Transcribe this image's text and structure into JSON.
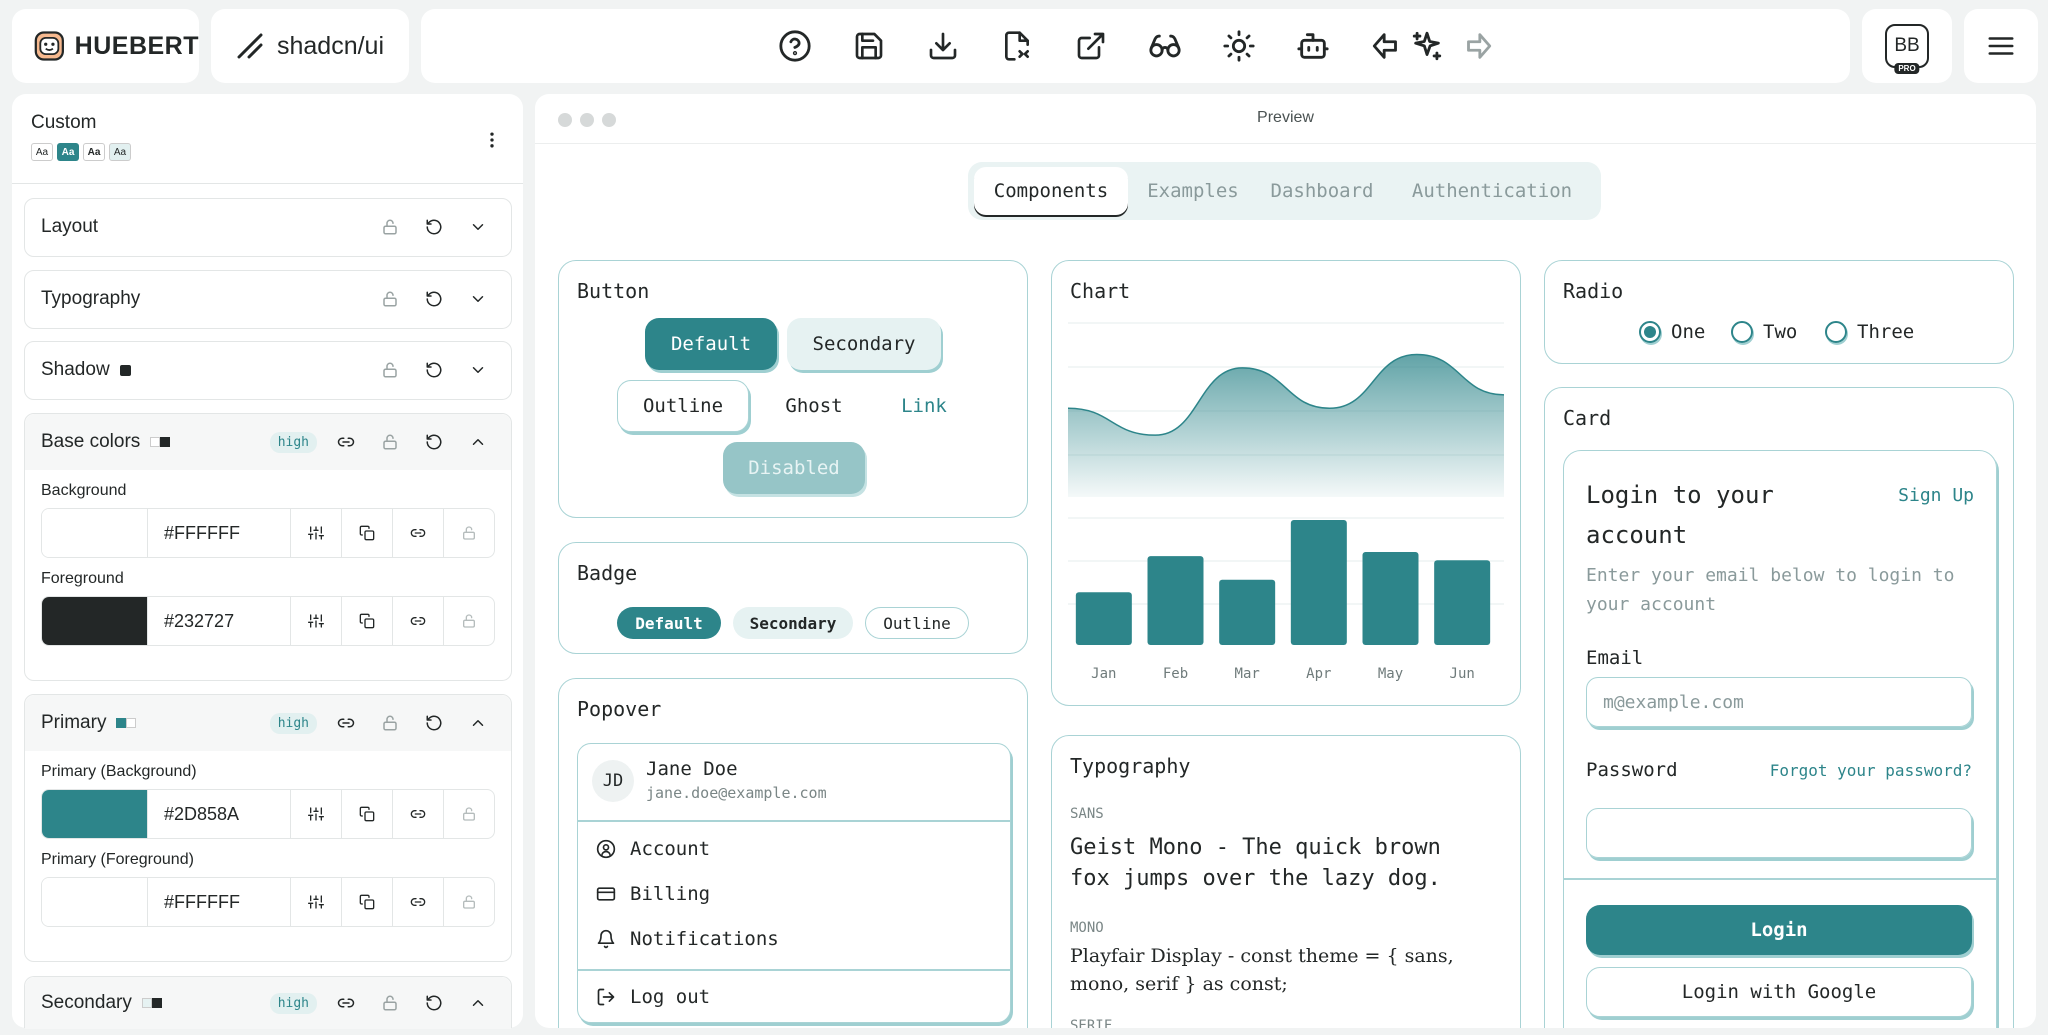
{
  "app": {
    "logo": "HUEBERT",
    "framework": "shadcn/ui"
  },
  "toolbar": {
    "icons": [
      "help-icon",
      "save-icon",
      "download-icon",
      "file-code-icon",
      "external-link-icon",
      "glasses-icon",
      "sun-icon",
      "bot-icon",
      "undo-icon",
      "sparkles-icon",
      "redo-icon"
    ]
  },
  "user": {
    "initials": "BB",
    "tier": "PRO"
  },
  "theme": {
    "name": "Custom",
    "font_samples": [
      "Aa",
      "Aa",
      "Aa",
      "Aa"
    ]
  },
  "sections": {
    "layout": "Layout",
    "typography": "Typography",
    "shadow": "Shadow",
    "base_colors": {
      "title": "Base colors",
      "contrast": "high",
      "background": {
        "label": "Background",
        "hex": "#FFFFFF"
      },
      "foreground": {
        "label": "Foreground",
        "hex": "#232727"
      }
    },
    "primary": {
      "title": "Primary",
      "contrast": "high",
      "background": {
        "label": "Primary (Background)",
        "hex": "#2D858A"
      },
      "foreground": {
        "label": "Primary (Foreground)",
        "hex": "#FFFFFF"
      }
    },
    "secondary": {
      "title": "Secondary",
      "contrast": "high"
    }
  },
  "colors": {
    "primary": "#2D858A",
    "foreground": "#232727",
    "background": "#FFFFFF",
    "secondary": "#E6F2F2",
    "border": "#A9D3D5"
  },
  "preview": {
    "title": "Preview",
    "tabs": [
      "Components",
      "Examples",
      "Dashboard",
      "Authentication"
    ],
    "button_card": {
      "title": "Button",
      "default": "Default",
      "secondary": "Secondary",
      "outline": "Outline",
      "ghost": "Ghost",
      "link": "Link",
      "disabled": "Disabled"
    },
    "badge_card": {
      "title": "Badge",
      "default": "Default",
      "secondary": "Secondary",
      "outline": "Outline"
    },
    "popover_card": {
      "title": "Popover",
      "avatar": "JD",
      "name": "Jane Doe",
      "email": "jane.doe@example.com",
      "items": [
        "Account",
        "Billing",
        "Notifications"
      ],
      "logout": "Log out"
    },
    "chart_card": {
      "title": "Chart"
    },
    "typography_card": {
      "title": "Typography",
      "sans_label": "SANS",
      "sans_text": "Geist Mono - The quick brown fox jumps over the lazy dog.",
      "mono_label": "MONO",
      "mono_text": "Playfair Display - const theme = { sans, mono, serif } as const;",
      "serif_label": "SERIF"
    },
    "radio_card": {
      "title": "Radio",
      "options": [
        "One",
        "Two",
        "Three"
      ],
      "selected": "One"
    },
    "card_card": {
      "title": "Card",
      "heading": "Login to your account",
      "signup": "Sign Up",
      "description": "Enter your email below to login to your account",
      "email_label": "Email",
      "email_placeholder": "m@example.com",
      "password_label": "Password",
      "forgot": "Forgot your password?",
      "login": "Login",
      "login_google": "Login with Google"
    }
  },
  "chart_data": {
    "type": "bar",
    "categories": [
      "Jan",
      "Feb",
      "Mar",
      "Apr",
      "May",
      "Jun"
    ],
    "values": [
      38,
      64,
      47,
      90,
      67,
      61
    ],
    "title": "",
    "area_series": {
      "type": "area",
      "values": [
        60,
        40,
        90,
        60,
        100,
        70
      ]
    }
  }
}
